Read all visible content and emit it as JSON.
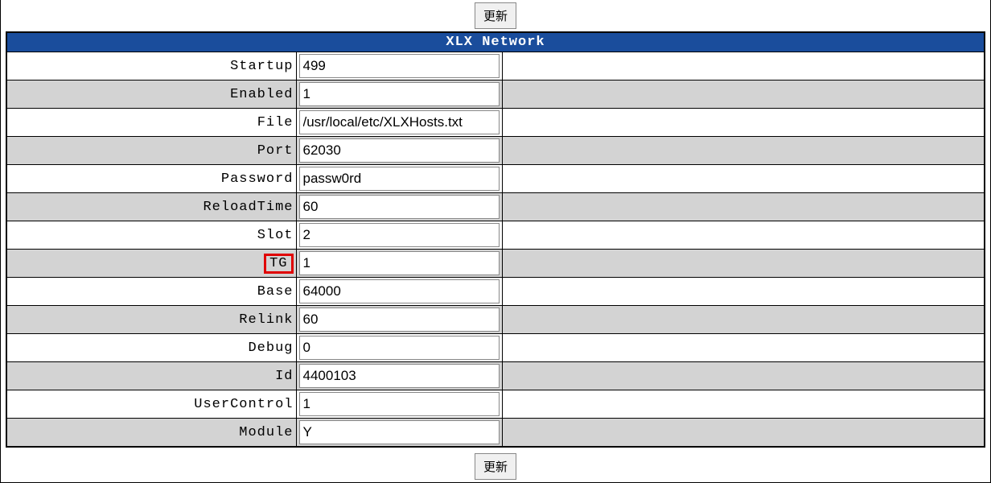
{
  "buttons": {
    "update_top": "更新",
    "update_bottom": "更新"
  },
  "section": {
    "title": "XLX Network"
  },
  "fields": [
    {
      "label": "Startup",
      "value": "499",
      "name": "startup",
      "shade": "white",
      "highlight": false
    },
    {
      "label": "Enabled",
      "value": "1",
      "name": "enabled",
      "shade": "gray",
      "highlight": false
    },
    {
      "label": "File",
      "value": "/usr/local/etc/XLXHosts.txt",
      "name": "file",
      "shade": "white",
      "highlight": false
    },
    {
      "label": "Port",
      "value": "62030",
      "name": "port",
      "shade": "gray",
      "highlight": false
    },
    {
      "label": "Password",
      "value": "passw0rd",
      "name": "password",
      "shade": "white",
      "highlight": false
    },
    {
      "label": "ReloadTime",
      "value": "60",
      "name": "reloadtime",
      "shade": "gray",
      "highlight": false
    },
    {
      "label": "Slot",
      "value": "2",
      "name": "slot",
      "shade": "white",
      "highlight": false
    },
    {
      "label": "TG",
      "value": "1",
      "name": "tg",
      "shade": "gray",
      "highlight": true
    },
    {
      "label": "Base",
      "value": "64000",
      "name": "base",
      "shade": "white",
      "highlight": false
    },
    {
      "label": "Relink",
      "value": "60",
      "name": "relink",
      "shade": "gray",
      "highlight": false
    },
    {
      "label": "Debug",
      "value": "0",
      "name": "debug",
      "shade": "white",
      "highlight": false
    },
    {
      "label": "Id",
      "value": "4400103",
      "name": "id",
      "shade": "gray",
      "highlight": false
    },
    {
      "label": "UserControl",
      "value": "1",
      "name": "usercontrol",
      "shade": "white",
      "highlight": false
    },
    {
      "label": "Module",
      "value": "Y",
      "name": "module",
      "shade": "gray",
      "highlight": false
    }
  ]
}
